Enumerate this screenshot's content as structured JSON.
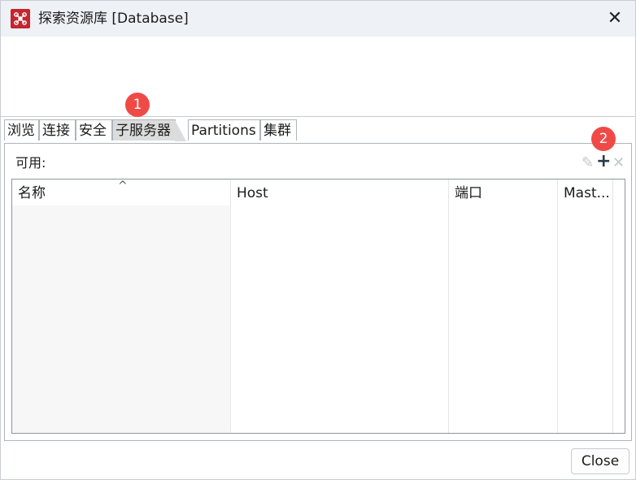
{
  "window": {
    "title": "探索资源库 [Database]",
    "close_glyph": "✕"
  },
  "tabs": [
    {
      "label": "浏览",
      "active": false
    },
    {
      "label": "连接",
      "active": false
    },
    {
      "label": "安全",
      "active": false
    },
    {
      "label": "子服务器",
      "active": true
    },
    {
      "label": "Partitions",
      "active": false
    },
    {
      "label": "集群",
      "active": false
    }
  ],
  "panel": {
    "available_label": "可用:",
    "tools": {
      "edit": "✎",
      "add": "+",
      "remove": "✕"
    }
  },
  "table": {
    "columns": [
      "名称",
      "Host",
      "端口",
      "Mast..."
    ],
    "sort_indicator": "^",
    "rows": []
  },
  "markers": [
    "1",
    "2"
  ],
  "footer": {
    "close_label": "Close"
  },
  "colors": {
    "accent_red": "#f04a47",
    "app_icon": "#c4262e",
    "active_tab": "#dcdcdc"
  }
}
